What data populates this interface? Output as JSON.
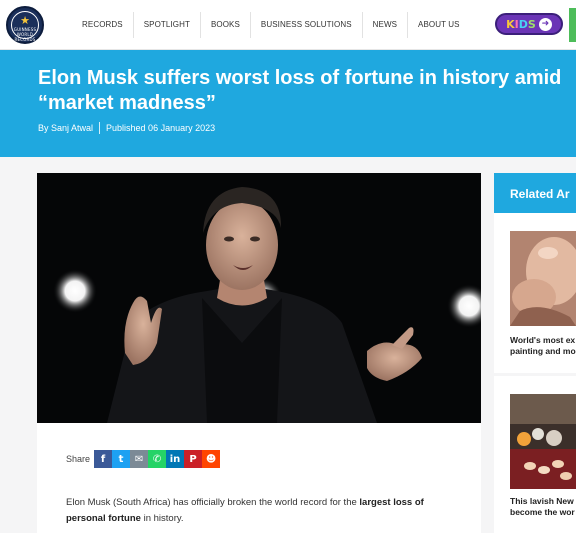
{
  "header": {
    "logo_text": "GUINNESS WORLD RECORDS",
    "nav": [
      {
        "label": "RECORDS"
      },
      {
        "label": "SPOTLIGHT"
      },
      {
        "label": "BOOKS"
      },
      {
        "label": "BUSINESS SOLUTIONS"
      },
      {
        "label": "NEWS"
      },
      {
        "label": "ABOUT US"
      }
    ],
    "kids": {
      "k1": "K",
      "k2": "I",
      "k3": "D",
      "k4": "S",
      "arrow": "➜"
    }
  },
  "article": {
    "title": "Elon Musk suffers worst loss of fortune in history amid\n“market madness”",
    "author": "By Sanj Atwal",
    "published": "Published 06 January 2023",
    "share_label": "Share",
    "share_buttons": [
      {
        "icon": "facebook-icon",
        "glyph": "f"
      },
      {
        "icon": "twitter-icon",
        "glyph": "🐦"
      },
      {
        "icon": "email-icon",
        "glyph": "✉"
      },
      {
        "icon": "whatsapp-icon",
        "glyph": "✆"
      },
      {
        "icon": "linkedin-icon",
        "glyph": "in"
      },
      {
        "icon": "pinterest-icon",
        "glyph": "P"
      },
      {
        "icon": "reddit-icon",
        "glyph": "☻"
      }
    ],
    "body_pre": "Elon Musk (South Africa) has officially broken the world record for the ",
    "body_bold1": "largest loss of personal fortune",
    "body_post": " in history."
  },
  "sidebar": {
    "heading": "Related Ar",
    "items": [
      {
        "caption": "World's most ex\npainting and mo"
      },
      {
        "caption": "This lavish New\nbecome the wor"
      }
    ]
  },
  "colors": {
    "accent": "#1fa8df",
    "nav_text": "#333333",
    "background": "#f5f5f6"
  }
}
